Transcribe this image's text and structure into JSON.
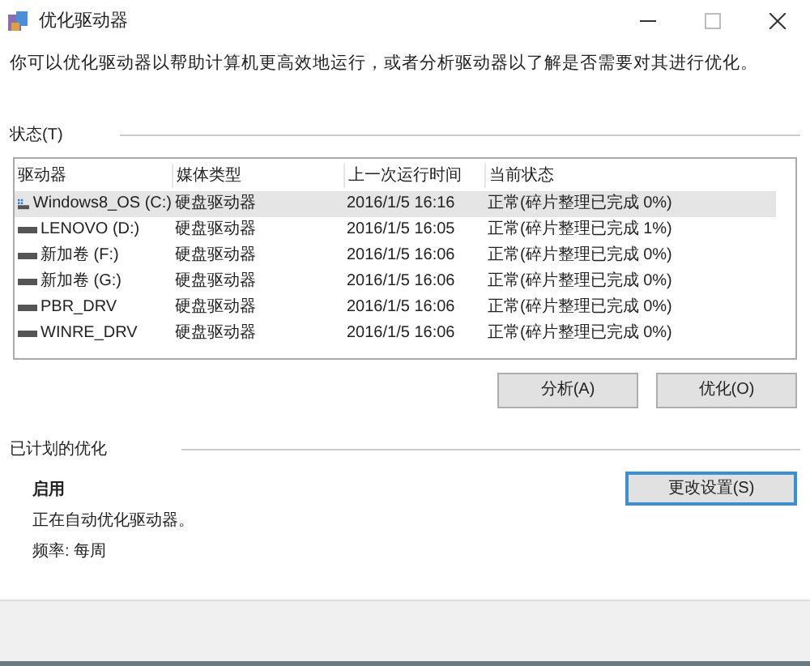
{
  "window": {
    "title": "优化驱动器"
  },
  "description": "你可以优化驱动器以帮助计算机更高效地运行，或者分析驱动器以了解是否需要对其进行优化。",
  "status_section": {
    "label": "状态(T)"
  },
  "table": {
    "columns": [
      "驱动器",
      "媒体类型",
      "上一次运行时间",
      "当前状态"
    ],
    "rows": [
      {
        "kind": "system",
        "drive": "Windows8_OS (C:)",
        "media": "硬盘驱动器",
        "last_run": "2016/1/5 16:16",
        "status": "正常(碎片整理已完成 0%)",
        "selected": true
      },
      {
        "kind": "disk",
        "drive": "LENOVO (D:)",
        "media": "硬盘驱动器",
        "last_run": "2016/1/5 16:05",
        "status": "正常(碎片整理已完成 1%)",
        "selected": false
      },
      {
        "kind": "disk",
        "drive": "新加卷 (F:)",
        "media": "硬盘驱动器",
        "last_run": "2016/1/5 16:06",
        "status": "正常(碎片整理已完成 0%)",
        "selected": false
      },
      {
        "kind": "disk",
        "drive": "新加卷 (G:)",
        "media": "硬盘驱动器",
        "last_run": "2016/1/5 16:06",
        "status": "正常(碎片整理已完成 0%)",
        "selected": false
      },
      {
        "kind": "disk",
        "drive": "PBR_DRV",
        "media": "硬盘驱动器",
        "last_run": "2016/1/5 16:06",
        "status": "正常(碎片整理已完成 0%)",
        "selected": false
      },
      {
        "kind": "disk",
        "drive": "WINRE_DRV",
        "media": "硬盘驱动器",
        "last_run": "2016/1/5 16:06",
        "status": "正常(碎片整理已完成 0%)",
        "selected": false
      }
    ]
  },
  "actions": [
    "分析(A)",
    "优化(O)"
  ],
  "scheduled": {
    "label": "已计划的优化",
    "state": "启用",
    "detail": "正在自动优化驱动器。",
    "frequency": "频率: 每周",
    "button": "更改设置(S)"
  }
}
